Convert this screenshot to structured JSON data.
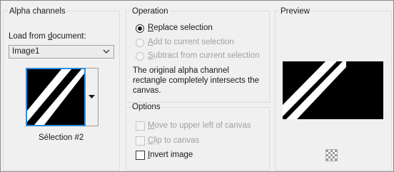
{
  "alpha_channels": {
    "title": "Alpha channels",
    "load_label_prefix": "Load from ",
    "load_label_underlined": "d",
    "load_label_suffix": "ocument:",
    "document_select_value": "Image1",
    "selection_name": "Sélection #2"
  },
  "operation": {
    "title": "Operation",
    "options": [
      {
        "u": "R",
        "rest": "eplace selection",
        "selected": true,
        "enabled": true
      },
      {
        "u": "A",
        "rest": "dd to current selection",
        "selected": false,
        "enabled": false
      },
      {
        "u": "S",
        "rest": "ubtract from current selection",
        "selected": false,
        "enabled": false
      }
    ],
    "description_line1": "The original alpha channel",
    "description_line2": "rectangle completely intersects the",
    "description_line3": "canvas."
  },
  "options": {
    "title": "Options",
    "items": [
      {
        "u": "M",
        "rest": "ove to upper left of canvas",
        "checked": false,
        "enabled": false
      },
      {
        "u": "C",
        "rest": "lip to canvas",
        "checked": false,
        "enabled": false
      },
      {
        "u": "I",
        "rest": "nvert image",
        "checked": false,
        "enabled": true
      }
    ]
  },
  "preview": {
    "title": "Preview",
    "background_icon": "transparency-checker-icon"
  },
  "colors": {
    "accent": "#2f8ee0",
    "preview_fill": "#000000"
  }
}
